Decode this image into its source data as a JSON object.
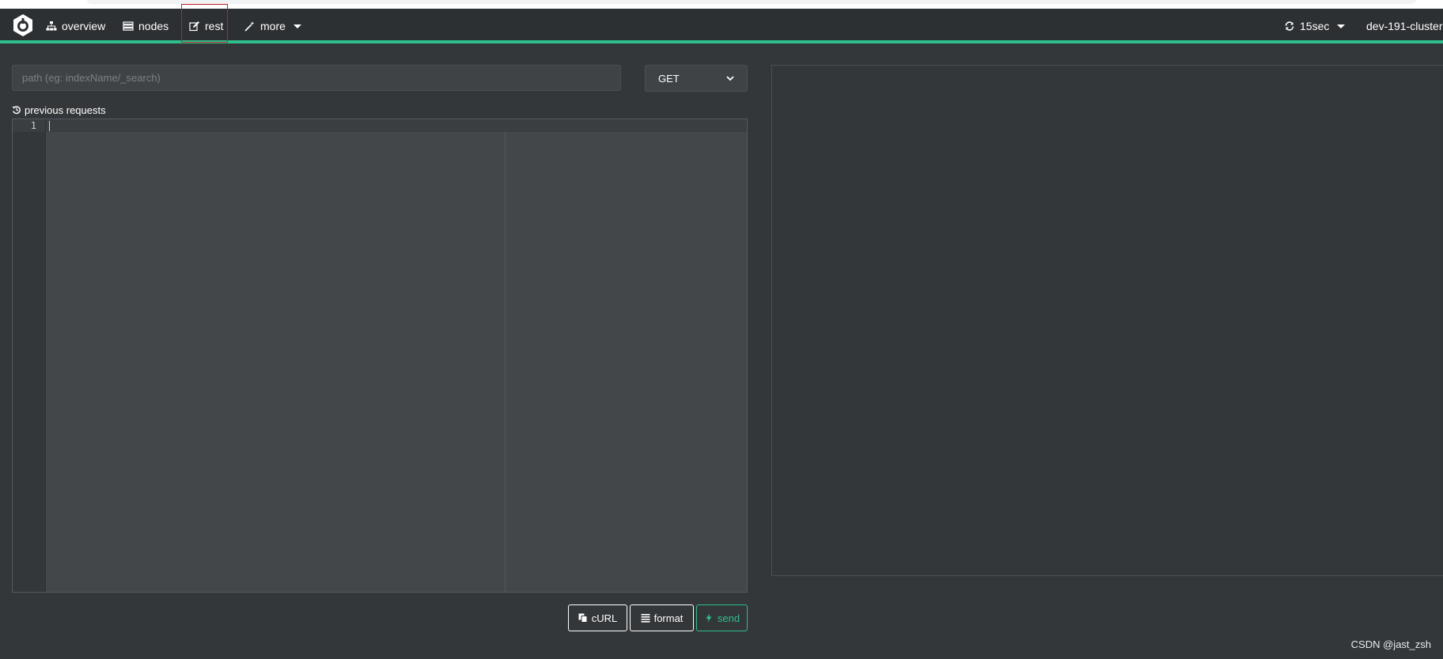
{
  "nav": {
    "items": [
      {
        "label": "overview",
        "icon": "sitemap-icon"
      },
      {
        "label": "nodes",
        "icon": "server-icon"
      },
      {
        "label": "rest",
        "icon": "edit-icon"
      },
      {
        "label": "more",
        "icon": "magic-wand-icon"
      }
    ],
    "refresh_interval": "15sec",
    "cluster_name": "dev-191-cluster"
  },
  "rest": {
    "path_placeholder": "path (eg: indexName/_search)",
    "method": "GET",
    "previous_requests_label": "previous requests",
    "editor_line": "1",
    "buttons": {
      "curl": "cURL",
      "format": "format",
      "send": "send"
    }
  },
  "watermark": "CSDN @jast_zsh",
  "colors": {
    "accent": "#2fbf8c",
    "navbar": "#2d3033",
    "background": "#34373a",
    "highlight": "#c0202a"
  }
}
